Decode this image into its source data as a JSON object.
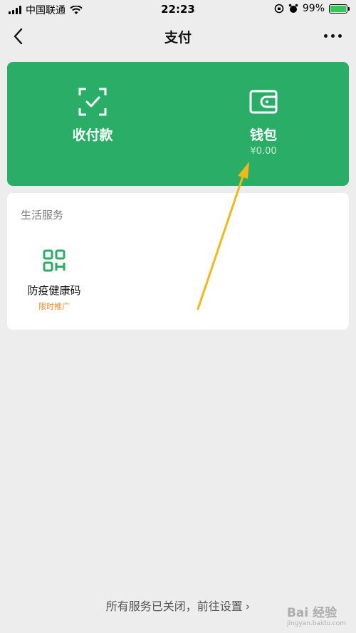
{
  "status_bar": {
    "carrier": "中国联通",
    "time": "22:23",
    "battery": "99%",
    "battery_level": 0.99
  },
  "nav": {
    "title": "支付",
    "back_icon": "chevron-left-icon",
    "more_icon": "more-dots-icon"
  },
  "pay_card": {
    "receive_pay": {
      "label": "收付款",
      "icon": "scan-check-icon"
    },
    "wallet": {
      "label": "钱包",
      "balance": "¥0.00",
      "icon": "wallet-icon"
    },
    "color": "#2aae67"
  },
  "services": {
    "section_title": "生活服务",
    "items": [
      {
        "label": "防疫健康码",
        "tag": "限时推广",
        "icon": "qr-code-icon"
      }
    ]
  },
  "footer": {
    "text": "所有服务已关闭，前往设置",
    "chevron": "›"
  },
  "watermark": {
    "text": "Bai 经验",
    "sub": "jingyan.baidu.com"
  },
  "colors": {
    "accent_green": "#2aae67",
    "background": "#ededed",
    "tag_orange": "#e6912e",
    "annotation_arrow": "#f0b81a"
  }
}
